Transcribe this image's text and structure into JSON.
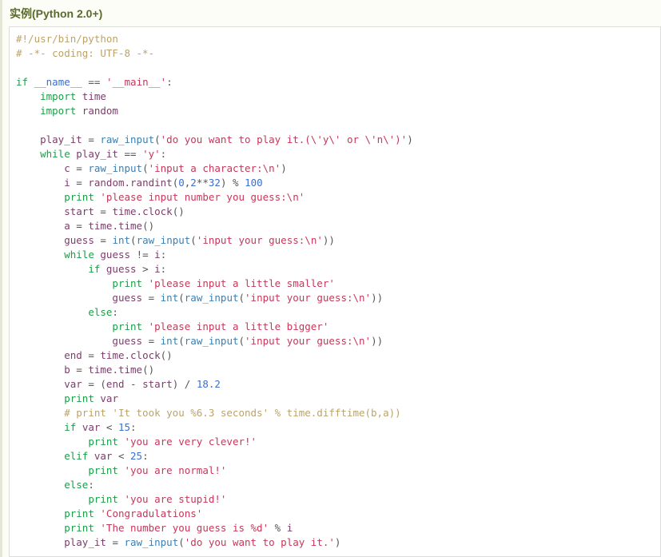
{
  "example": {
    "title": "实例(Python 2.0+)",
    "language": "python",
    "title_color": "#5b6a2b",
    "accent_color": "#e2e8d5",
    "panel_background": "#fcfdf7",
    "code_background": "#ffffff",
    "code_border_color": "#dddddd"
  },
  "syntax_colors": {
    "comment": "#bba36a",
    "keyword": "#1a9e48",
    "string": "#c4385a",
    "number": "#3b6fcf",
    "builtin": "#3c7fb1",
    "identifier": "#7a3d6b",
    "operator": "#555555",
    "plain": "#333333"
  },
  "code": {
    "lines": [
      [
        {
          "t": "#!/usr/bin/python",
          "c": "com"
        }
      ],
      [
        {
          "t": "# -*- coding: UTF-8 -*-",
          "c": "com"
        }
      ],
      [],
      [
        {
          "t": "if",
          "c": "kw"
        },
        {
          "t": " ",
          "c": "pl"
        },
        {
          "t": "__name__",
          "c": "dun"
        },
        {
          "t": " ",
          "c": "pl"
        },
        {
          "t": "==",
          "c": "op"
        },
        {
          "t": " ",
          "c": "pl"
        },
        {
          "t": "'__main__'",
          "c": "str"
        },
        {
          "t": ":",
          "c": "op"
        }
      ],
      [
        {
          "t": "    ",
          "c": "pl"
        },
        {
          "t": "import",
          "c": "kw"
        },
        {
          "t": " ",
          "c": "pl"
        },
        {
          "t": "time",
          "c": "var"
        }
      ],
      [
        {
          "t": "    ",
          "c": "pl"
        },
        {
          "t": "import",
          "c": "kw"
        },
        {
          "t": " ",
          "c": "pl"
        },
        {
          "t": "random",
          "c": "var"
        }
      ],
      [],
      [
        {
          "t": "    ",
          "c": "pl"
        },
        {
          "t": "play_it",
          "c": "var"
        },
        {
          "t": " ",
          "c": "pl"
        },
        {
          "t": "=",
          "c": "op"
        },
        {
          "t": " ",
          "c": "pl"
        },
        {
          "t": "raw_input",
          "c": "fn"
        },
        {
          "t": "(",
          "c": "op"
        },
        {
          "t": "'do you want to play it.(\\'y\\' or \\'n\\')'",
          "c": "str"
        },
        {
          "t": ")",
          "c": "op"
        }
      ],
      [
        {
          "t": "    ",
          "c": "pl"
        },
        {
          "t": "while",
          "c": "kw"
        },
        {
          "t": " ",
          "c": "pl"
        },
        {
          "t": "play_it",
          "c": "var"
        },
        {
          "t": " ",
          "c": "pl"
        },
        {
          "t": "==",
          "c": "op"
        },
        {
          "t": " ",
          "c": "pl"
        },
        {
          "t": "'y'",
          "c": "str"
        },
        {
          "t": ":",
          "c": "op"
        }
      ],
      [
        {
          "t": "        ",
          "c": "pl"
        },
        {
          "t": "c",
          "c": "var"
        },
        {
          "t": " ",
          "c": "pl"
        },
        {
          "t": "=",
          "c": "op"
        },
        {
          "t": " ",
          "c": "pl"
        },
        {
          "t": "raw_input",
          "c": "fn"
        },
        {
          "t": "(",
          "c": "op"
        },
        {
          "t": "'input a character:\\n'",
          "c": "str"
        },
        {
          "t": ")",
          "c": "op"
        }
      ],
      [
        {
          "t": "        ",
          "c": "pl"
        },
        {
          "t": "i",
          "c": "var"
        },
        {
          "t": " ",
          "c": "pl"
        },
        {
          "t": "=",
          "c": "op"
        },
        {
          "t": " ",
          "c": "pl"
        },
        {
          "t": "random.randint",
          "c": "var"
        },
        {
          "t": "(",
          "c": "op"
        },
        {
          "t": "0",
          "c": "num"
        },
        {
          "t": ",",
          "c": "op"
        },
        {
          "t": "2",
          "c": "num"
        },
        {
          "t": "**",
          "c": "op"
        },
        {
          "t": "32",
          "c": "num"
        },
        {
          "t": ")",
          "c": "op"
        },
        {
          "t": " ",
          "c": "pl"
        },
        {
          "t": "%",
          "c": "op"
        },
        {
          "t": " ",
          "c": "pl"
        },
        {
          "t": "100",
          "c": "num"
        }
      ],
      [
        {
          "t": "        ",
          "c": "pl"
        },
        {
          "t": "print",
          "c": "kw"
        },
        {
          "t": " ",
          "c": "pl"
        },
        {
          "t": "'please input number you guess:\\n'",
          "c": "str"
        }
      ],
      [
        {
          "t": "        ",
          "c": "pl"
        },
        {
          "t": "start",
          "c": "var"
        },
        {
          "t": " ",
          "c": "pl"
        },
        {
          "t": "=",
          "c": "op"
        },
        {
          "t": " ",
          "c": "pl"
        },
        {
          "t": "time.clock",
          "c": "var"
        },
        {
          "t": "()",
          "c": "op"
        }
      ],
      [
        {
          "t": "        ",
          "c": "pl"
        },
        {
          "t": "a",
          "c": "var"
        },
        {
          "t": " ",
          "c": "pl"
        },
        {
          "t": "=",
          "c": "op"
        },
        {
          "t": " ",
          "c": "pl"
        },
        {
          "t": "time.time",
          "c": "var"
        },
        {
          "t": "()",
          "c": "op"
        }
      ],
      [
        {
          "t": "        ",
          "c": "pl"
        },
        {
          "t": "guess",
          "c": "var"
        },
        {
          "t": " ",
          "c": "pl"
        },
        {
          "t": "=",
          "c": "op"
        },
        {
          "t": " ",
          "c": "pl"
        },
        {
          "t": "int",
          "c": "fn"
        },
        {
          "t": "(",
          "c": "op"
        },
        {
          "t": "raw_input",
          "c": "fn"
        },
        {
          "t": "(",
          "c": "op"
        },
        {
          "t": "'input your guess:\\n'",
          "c": "str"
        },
        {
          "t": "))",
          "c": "op"
        }
      ],
      [
        {
          "t": "        ",
          "c": "pl"
        },
        {
          "t": "while",
          "c": "kw"
        },
        {
          "t": " ",
          "c": "pl"
        },
        {
          "t": "guess",
          "c": "var"
        },
        {
          "t": " ",
          "c": "pl"
        },
        {
          "t": "!=",
          "c": "op"
        },
        {
          "t": " ",
          "c": "pl"
        },
        {
          "t": "i",
          "c": "var"
        },
        {
          "t": ":",
          "c": "op"
        }
      ],
      [
        {
          "t": "            ",
          "c": "pl"
        },
        {
          "t": "if",
          "c": "kw"
        },
        {
          "t": " ",
          "c": "pl"
        },
        {
          "t": "guess",
          "c": "var"
        },
        {
          "t": " ",
          "c": "pl"
        },
        {
          "t": ">",
          "c": "op"
        },
        {
          "t": " ",
          "c": "pl"
        },
        {
          "t": "i",
          "c": "var"
        },
        {
          "t": ":",
          "c": "op"
        }
      ],
      [
        {
          "t": "                ",
          "c": "pl"
        },
        {
          "t": "print",
          "c": "kw"
        },
        {
          "t": " ",
          "c": "pl"
        },
        {
          "t": "'please input a little smaller'",
          "c": "str"
        }
      ],
      [
        {
          "t": "                ",
          "c": "pl"
        },
        {
          "t": "guess",
          "c": "var"
        },
        {
          "t": " ",
          "c": "pl"
        },
        {
          "t": "=",
          "c": "op"
        },
        {
          "t": " ",
          "c": "pl"
        },
        {
          "t": "int",
          "c": "fn"
        },
        {
          "t": "(",
          "c": "op"
        },
        {
          "t": "raw_input",
          "c": "fn"
        },
        {
          "t": "(",
          "c": "op"
        },
        {
          "t": "'input your guess:\\n'",
          "c": "str"
        },
        {
          "t": "))",
          "c": "op"
        }
      ],
      [
        {
          "t": "            ",
          "c": "pl"
        },
        {
          "t": "else",
          "c": "kw"
        },
        {
          "t": ":",
          "c": "op"
        }
      ],
      [
        {
          "t": "                ",
          "c": "pl"
        },
        {
          "t": "print",
          "c": "kw"
        },
        {
          "t": " ",
          "c": "pl"
        },
        {
          "t": "'please input a little bigger'",
          "c": "str"
        }
      ],
      [
        {
          "t": "                ",
          "c": "pl"
        },
        {
          "t": "guess",
          "c": "var"
        },
        {
          "t": " ",
          "c": "pl"
        },
        {
          "t": "=",
          "c": "op"
        },
        {
          "t": " ",
          "c": "pl"
        },
        {
          "t": "int",
          "c": "fn"
        },
        {
          "t": "(",
          "c": "op"
        },
        {
          "t": "raw_input",
          "c": "fn"
        },
        {
          "t": "(",
          "c": "op"
        },
        {
          "t": "'input your guess:\\n'",
          "c": "str"
        },
        {
          "t": "))",
          "c": "op"
        }
      ],
      [
        {
          "t": "        ",
          "c": "pl"
        },
        {
          "t": "end",
          "c": "var"
        },
        {
          "t": " ",
          "c": "pl"
        },
        {
          "t": "=",
          "c": "op"
        },
        {
          "t": " ",
          "c": "pl"
        },
        {
          "t": "time.clock",
          "c": "var"
        },
        {
          "t": "()",
          "c": "op"
        }
      ],
      [
        {
          "t": "        ",
          "c": "pl"
        },
        {
          "t": "b",
          "c": "var"
        },
        {
          "t": " ",
          "c": "pl"
        },
        {
          "t": "=",
          "c": "op"
        },
        {
          "t": " ",
          "c": "pl"
        },
        {
          "t": "time.time",
          "c": "var"
        },
        {
          "t": "()",
          "c": "op"
        }
      ],
      [
        {
          "t": "        ",
          "c": "pl"
        },
        {
          "t": "var",
          "c": "var"
        },
        {
          "t": " ",
          "c": "pl"
        },
        {
          "t": "=",
          "c": "op"
        },
        {
          "t": " ",
          "c": "pl"
        },
        {
          "t": "(",
          "c": "op"
        },
        {
          "t": "end",
          "c": "var"
        },
        {
          "t": " ",
          "c": "pl"
        },
        {
          "t": "-",
          "c": "op"
        },
        {
          "t": " ",
          "c": "pl"
        },
        {
          "t": "start",
          "c": "var"
        },
        {
          "t": ")",
          "c": "op"
        },
        {
          "t": " ",
          "c": "pl"
        },
        {
          "t": "/",
          "c": "op"
        },
        {
          "t": " ",
          "c": "pl"
        },
        {
          "t": "18.2",
          "c": "num"
        }
      ],
      [
        {
          "t": "        ",
          "c": "pl"
        },
        {
          "t": "print",
          "c": "kw"
        },
        {
          "t": " ",
          "c": "pl"
        },
        {
          "t": "var",
          "c": "var"
        }
      ],
      [
        {
          "t": "        ",
          "c": "pl"
        },
        {
          "t": "# print 'It took you %6.3 seconds' % time.difftime(b,a))",
          "c": "com"
        }
      ],
      [
        {
          "t": "        ",
          "c": "pl"
        },
        {
          "t": "if",
          "c": "kw"
        },
        {
          "t": " ",
          "c": "pl"
        },
        {
          "t": "var",
          "c": "var"
        },
        {
          "t": " ",
          "c": "pl"
        },
        {
          "t": "<",
          "c": "op"
        },
        {
          "t": " ",
          "c": "pl"
        },
        {
          "t": "15",
          "c": "num"
        },
        {
          "t": ":",
          "c": "op"
        }
      ],
      [
        {
          "t": "            ",
          "c": "pl"
        },
        {
          "t": "print",
          "c": "kw"
        },
        {
          "t": " ",
          "c": "pl"
        },
        {
          "t": "'you are very clever!'",
          "c": "str"
        }
      ],
      [
        {
          "t": "        ",
          "c": "pl"
        },
        {
          "t": "elif",
          "c": "kw"
        },
        {
          "t": " ",
          "c": "pl"
        },
        {
          "t": "var",
          "c": "var"
        },
        {
          "t": " ",
          "c": "pl"
        },
        {
          "t": "<",
          "c": "op"
        },
        {
          "t": " ",
          "c": "pl"
        },
        {
          "t": "25",
          "c": "num"
        },
        {
          "t": ":",
          "c": "op"
        }
      ],
      [
        {
          "t": "            ",
          "c": "pl"
        },
        {
          "t": "print",
          "c": "kw"
        },
        {
          "t": " ",
          "c": "pl"
        },
        {
          "t": "'you are normal!'",
          "c": "str"
        }
      ],
      [
        {
          "t": "        ",
          "c": "pl"
        },
        {
          "t": "else",
          "c": "kw"
        },
        {
          "t": ":",
          "c": "op"
        }
      ],
      [
        {
          "t": "            ",
          "c": "pl"
        },
        {
          "t": "print",
          "c": "kw"
        },
        {
          "t": " ",
          "c": "pl"
        },
        {
          "t": "'you are stupid!'",
          "c": "str"
        }
      ],
      [
        {
          "t": "        ",
          "c": "pl"
        },
        {
          "t": "print",
          "c": "kw"
        },
        {
          "t": " ",
          "c": "pl"
        },
        {
          "t": "'Congradulations'",
          "c": "str"
        }
      ],
      [
        {
          "t": "        ",
          "c": "pl"
        },
        {
          "t": "print",
          "c": "kw"
        },
        {
          "t": " ",
          "c": "pl"
        },
        {
          "t": "'The number you guess is %d'",
          "c": "str"
        },
        {
          "t": " ",
          "c": "pl"
        },
        {
          "t": "%",
          "c": "op"
        },
        {
          "t": " ",
          "c": "pl"
        },
        {
          "t": "i",
          "c": "var"
        }
      ],
      [
        {
          "t": "        ",
          "c": "pl"
        },
        {
          "t": "play_it",
          "c": "var"
        },
        {
          "t": " ",
          "c": "pl"
        },
        {
          "t": "=",
          "c": "op"
        },
        {
          "t": " ",
          "c": "pl"
        },
        {
          "t": "raw_input",
          "c": "fn"
        },
        {
          "t": "(",
          "c": "op"
        },
        {
          "t": "'do you want to play it.'",
          "c": "str"
        },
        {
          "t": ")",
          "c": "op"
        }
      ]
    ]
  }
}
